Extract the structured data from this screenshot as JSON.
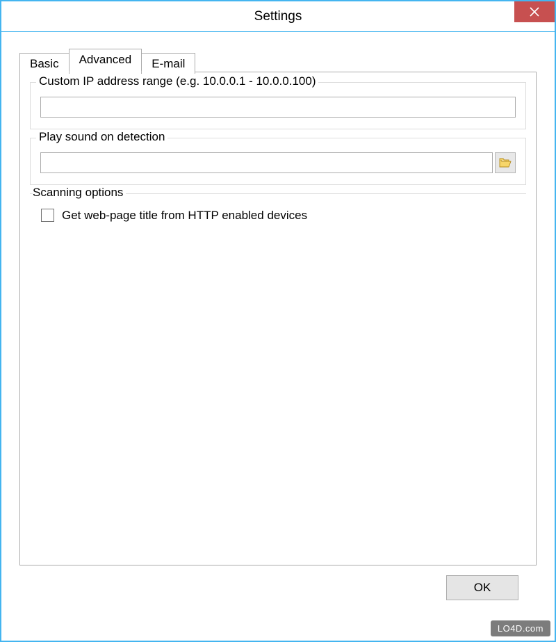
{
  "window": {
    "title": "Settings"
  },
  "tabs": {
    "basic": "Basic",
    "advanced": "Advanced",
    "email": "E-mail",
    "active": "advanced"
  },
  "groups": {
    "ip_range": {
      "legend": "Custom IP address range (e.g. 10.0.0.1 - 10.0.0.100)",
      "value": ""
    },
    "sound": {
      "legend": "Play sound on detection",
      "value": ""
    },
    "scan": {
      "legend": "Scanning options",
      "checkbox_label": "Get web-page title from HTTP enabled devices",
      "checkbox_checked": false
    }
  },
  "buttons": {
    "ok": "OK"
  },
  "watermark": "LO4D.com"
}
